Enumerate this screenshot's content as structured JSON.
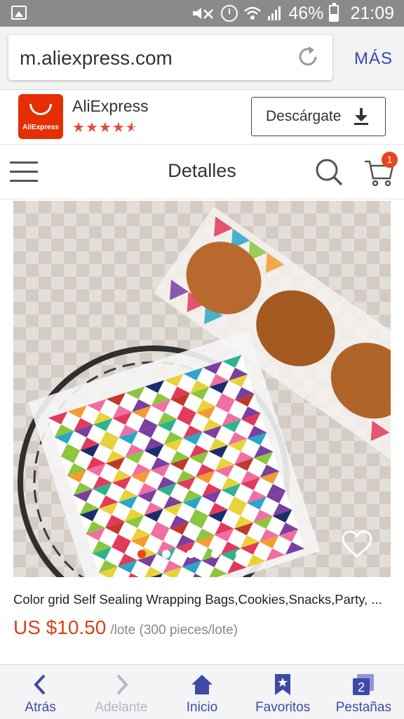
{
  "status_bar": {
    "battery_percent": "46%",
    "time": "21:09",
    "icons": [
      "gallery-icon",
      "mute-icon",
      "alarm-icon",
      "wifi-icon",
      "signal-icon",
      "battery-icon"
    ]
  },
  "browser": {
    "url": "m.aliexpress.com",
    "more_label": "MÁS",
    "accent_color": "#3a46b8"
  },
  "app_banner": {
    "logo_text": "AliExpress",
    "app_name": "AliExpress",
    "rating_stars": 4.5,
    "download_label": "Descárgate",
    "brand_color": "#e62e04"
  },
  "header": {
    "title": "Detalles",
    "cart_count": "1"
  },
  "product": {
    "image_count": 6,
    "active_image_index": 0,
    "title": "Color grid Self Sealing Wrapping Bags,Cookies,Snacks,Party, ...",
    "price": "US $10.50",
    "unit": "/lote (300 pieces/lote)",
    "price_color": "#d8411c"
  },
  "bottom_nav": {
    "items": [
      {
        "label": "Atrás",
        "icon": "chevron-left-icon",
        "enabled": true
      },
      {
        "label": "Adelante",
        "icon": "chevron-right-icon",
        "enabled": false
      },
      {
        "label": "Inicio",
        "icon": "home-icon",
        "enabled": true
      },
      {
        "label": "Favoritos",
        "icon": "bookmark-star-icon",
        "enabled": true
      },
      {
        "label": "Pestañas",
        "icon": "tabs-icon",
        "enabled": true,
        "badge": "2"
      }
    ]
  }
}
